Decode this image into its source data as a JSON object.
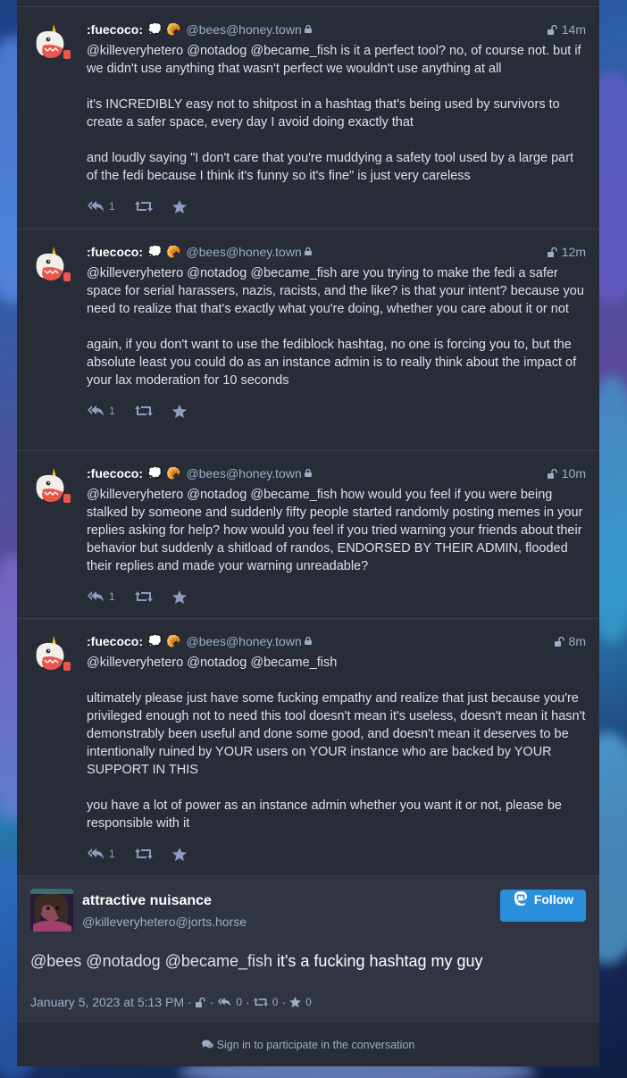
{
  "theme": {
    "accent": "#2b90d9",
    "column_bg": "#282c37",
    "text": "#d9e1e8",
    "muted": "#9baec8",
    "icon": "#8d9ac2"
  },
  "statuses": [
    {
      "display_name": ":fuecoco:",
      "acct": "@bees@honey.town",
      "time": "14m",
      "paragraphs": [
        "@killeveryhetero @notadog @became_fish is it a perfect tool? no, of course not. but if we didn't use anything that wasn't perfect we wouldn't use anything at all",
        "it's INCREDIBLY easy not to shitpost in a hashtag that's being used by survivors to create a safer space, every day I avoid doing exactly that",
        "and loudly saying \"I don't care that you're muddying a safety tool used by a large part of the fedi because I think it's funny so it's fine\" is just very careless"
      ],
      "reply_count": "1"
    },
    {
      "display_name": ":fuecoco:",
      "acct": "@bees@honey.town",
      "time": "12m",
      "paragraphs": [
        "@killeveryhetero @notadog @became_fish are you trying to make the fedi a safer space for serial harassers, nazis, racists, and the like? is that your intent? because you need to realize that that's exactly what you're doing, whether you care about it or not",
        "again, if you don't want to use the fediblock hashtag, no one is forcing you to, but the absolute least you could do as an instance admin is to really think about the impact of your lax moderation for 10 seconds"
      ],
      "reply_count": "1"
    },
    {
      "display_name": ":fuecoco:",
      "acct": "@bees@honey.town",
      "time": "10m",
      "paragraphs": [
        "@killeveryhetero @notadog @became_fish how would you feel if you were being stalked by someone and suddenly fifty people started randomly posting memes in your replies asking for help? how would you feel if you tried warning your friends about their behavior but suddenly a shitload of randos, ENDORSED BY THEIR ADMIN, flooded their replies and made your warning unreadable?"
      ],
      "reply_count": "1"
    },
    {
      "display_name": ":fuecoco:",
      "acct": "@bees@honey.town",
      "time": "8m",
      "paragraphs": [
        "@killeveryhetero @notadog @became_fish",
        "ultimately please just have some fucking empathy and realize that just because you're privileged enough not to need this tool doesn't mean it's useless, doesn't mean it hasn't demonstrably been useful and done some good, and doesn't mean it deserves to be intentionally ruined by YOUR users on YOUR instance who are backed by YOUR SUPPORT IN THIS",
        "you have a lot of power as an instance admin whether you want it or not, please be responsible with it"
      ],
      "reply_count": "1"
    }
  ],
  "focused": {
    "display_name": "attractive nuisance",
    "acct": "@killeveryhetero@jorts.horse",
    "follow_label": "Follow",
    "mentions": "@bees @notadog @became_fish",
    "text": " it's a fucking hashtag my guy",
    "date": "January 5, 2023 at 5:13 PM",
    "replies": "0",
    "boosts": "0",
    "favourites": "0"
  },
  "footer": {
    "signin_text": "Sign in to participate in the conversation"
  }
}
